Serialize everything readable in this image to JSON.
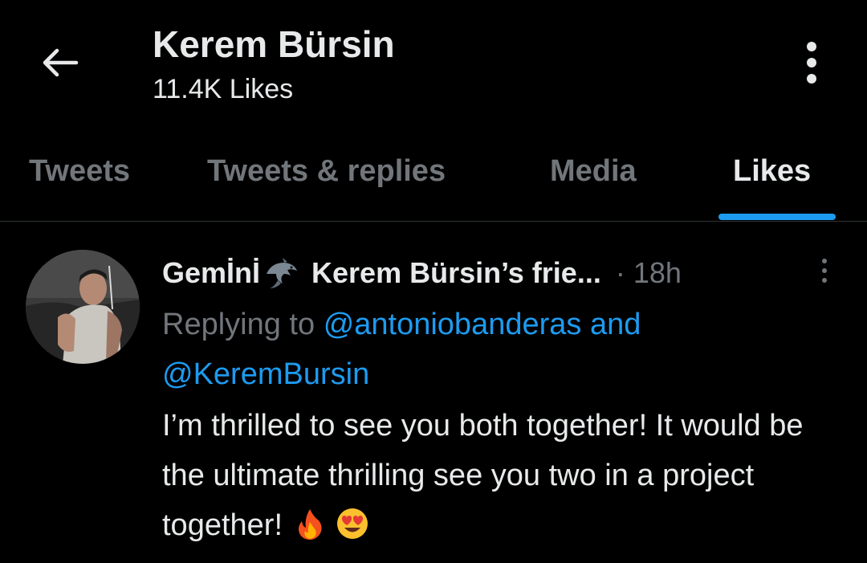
{
  "header": {
    "title": "Kerem Bürsin",
    "subtitle": "11.4K Likes",
    "back_icon": "arrow-left-icon",
    "more_icon": "vertical-dots-icon"
  },
  "tabs": [
    {
      "label": "Tweets",
      "active": false
    },
    {
      "label": "Tweets & replies",
      "active": false
    },
    {
      "label": "Media",
      "active": false
    },
    {
      "label": "Likes",
      "active": true
    }
  ],
  "tweet": {
    "author_name": "Gemİnİ",
    "author_emoji_icon": "dolphin-icon",
    "author_name_suffix": "Kerem Bürsin’s frie...",
    "separator": "·",
    "time": "18h",
    "replying_prefix": "Replying to",
    "mention_1": "@antoniobanderas",
    "mention_joiner": "and",
    "mention_2": "@KeremBursin",
    "text": "I’m thrilled to see you both together! It would be the ultimate thrilling see you two in a project together!",
    "emojis": [
      "fire-emoji",
      "heart-eyes-emoji"
    ]
  },
  "colors": {
    "background": "#000000",
    "text_primary": "#e7e9ea",
    "text_secondary": "#71767b",
    "accent": "#1d9bf0",
    "divider": "#2f3336"
  }
}
